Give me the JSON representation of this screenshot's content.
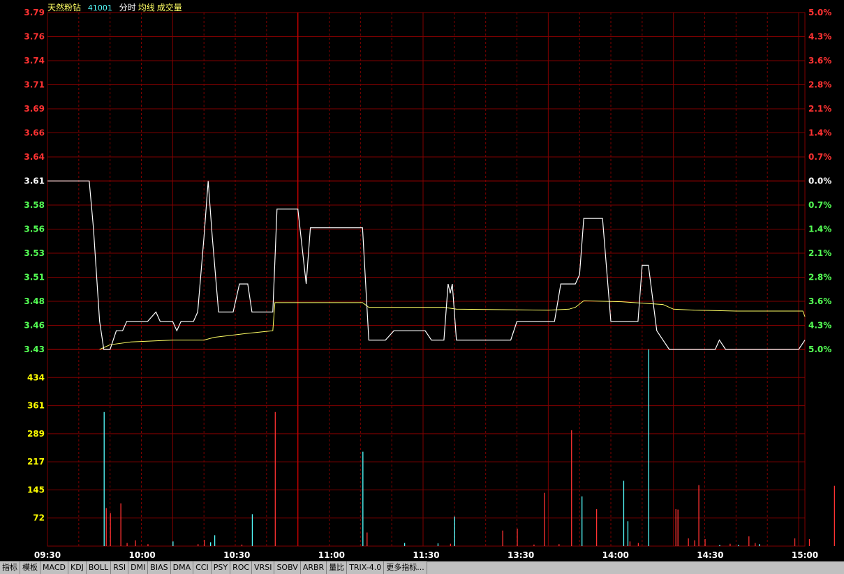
{
  "header": {
    "stock_name": "天然粉钻",
    "stock_code": "41001",
    "mode": "分时",
    "avg_label": "均线",
    "vol_label": "成交量"
  },
  "colors": {
    "up": "#ff3232",
    "down": "#54ff54",
    "flat": "#ffffff",
    "price_line": "#ffffff",
    "avg_line": "#ffff64",
    "vol_down": "#54ffff",
    "vol_up": "#ff3232",
    "grid": "#800000",
    "vol_axis": "#ffff00"
  },
  "tabs": [
    "指标",
    "模板",
    "MACD",
    "KDJ",
    "BOLL",
    "RSI",
    "DMI",
    "BIAS",
    "DMA",
    "CCI",
    "PSY",
    "ROC",
    "VRSI",
    "SOBV",
    "ARBR",
    "量比",
    "TRIX-4.0",
    "更多指标..."
  ],
  "chart_data": {
    "type": "line",
    "x_labels": [
      "09:30",
      "10:00",
      "10:30",
      "11:00",
      "11:30",
      "13:30",
      "14:00",
      "14:30",
      "15:00"
    ],
    "price_axis_labels": [
      "3.79",
      "3.76",
      "3.74",
      "3.71",
      "3.69",
      "3.66",
      "3.64",
      "3.61",
      "3.58",
      "3.56",
      "3.53",
      "3.51",
      "3.48",
      "3.46",
      "3.43"
    ],
    "pct_axis_labels": [
      "5.0%",
      "4.3%",
      "3.6%",
      "2.8%",
      "2.1%",
      "1.4%",
      "0.7%",
      "0.0%",
      "0.7%",
      "1.4%",
      "2.1%",
      "2.8%",
      "3.6%",
      "4.3%",
      "5.0%"
    ],
    "volume_axis_labels": [
      "434",
      "361",
      "289",
      "217",
      "145",
      "72"
    ],
    "pre_close": 3.61,
    "price_range": [
      3.43,
      3.79
    ],
    "volume_range": [
      0,
      506
    ],
    "price": [
      [
        0,
        3.61
      ],
      [
        20,
        3.61
      ],
      [
        22,
        3.56
      ],
      [
        25,
        3.46
      ],
      [
        27,
        3.43
      ],
      [
        30,
        3.43
      ],
      [
        33,
        3.45
      ],
      [
        36,
        3.45
      ],
      [
        38,
        3.46
      ],
      [
        45,
        3.46
      ],
      [
        48,
        3.46
      ],
      [
        52,
        3.47
      ],
      [
        54,
        3.46
      ],
      [
        60,
        3.46
      ],
      [
        62,
        3.45
      ],
      [
        64,
        3.46
      ],
      [
        70,
        3.46
      ],
      [
        72,
        3.47
      ],
      [
        75,
        3.55
      ],
      [
        77,
        3.61
      ],
      [
        79,
        3.55
      ],
      [
        82,
        3.47
      ],
      [
        89,
        3.47
      ],
      [
        92,
        3.5
      ],
      [
        96,
        3.5
      ],
      [
        98,
        3.47
      ],
      [
        108,
        3.47
      ],
      [
        110,
        3.58
      ],
      [
        120,
        3.58
      ],
      [
        124,
        3.5
      ],
      [
        126,
        3.56
      ],
      [
        151,
        3.56
      ],
      [
        154,
        3.44
      ],
      [
        162,
        3.44
      ],
      [
        166,
        3.45
      ],
      [
        181,
        3.45
      ],
      [
        184,
        3.44
      ],
      [
        190,
        3.44
      ],
      [
        192,
        3.5
      ],
      [
        193,
        3.49
      ],
      [
        194,
        3.5
      ],
      [
        196,
        3.44
      ],
      [
        222,
        3.44
      ],
      [
        225,
        3.46
      ],
      [
        243,
        3.46
      ],
      [
        246,
        3.5
      ],
      [
        253,
        3.5
      ],
      [
        255,
        3.51
      ],
      [
        257,
        3.57
      ],
      [
        266,
        3.57
      ],
      [
        270,
        3.46
      ],
      [
        283,
        3.46
      ],
      [
        285,
        3.52
      ],
      [
        288,
        3.52
      ],
      [
        292,
        3.45
      ],
      [
        295,
        3.44
      ],
      [
        298,
        3.43
      ],
      [
        320,
        3.43
      ],
      [
        322,
        3.44
      ],
      [
        325,
        3.43
      ],
      [
        360,
        3.43
      ],
      [
        363,
        3.44
      ]
    ],
    "avg": [
      [
        25,
        3.43
      ],
      [
        30,
        3.435
      ],
      [
        40,
        3.438
      ],
      [
        60,
        3.44
      ],
      [
        75,
        3.44
      ],
      [
        80,
        3.443
      ],
      [
        95,
        3.447
      ],
      [
        108,
        3.45
      ],
      [
        109,
        3.48
      ],
      [
        151,
        3.48
      ],
      [
        154,
        3.475
      ],
      [
        190,
        3.475
      ],
      [
        196,
        3.473
      ],
      [
        240,
        3.472
      ],
      [
        250,
        3.473
      ],
      [
        253,
        3.475
      ],
      [
        257,
        3.482
      ],
      [
        275,
        3.481
      ],
      [
        295,
        3.478
      ],
      [
        300,
        3.473
      ],
      [
        310,
        3.472
      ],
      [
        330,
        3.471
      ],
      [
        362,
        3.471
      ],
      [
        363,
        3.465
      ]
    ],
    "volume": [
      [
        27,
        345,
        "down"
      ],
      [
        28,
        98,
        "up"
      ],
      [
        30,
        85,
        "up"
      ],
      [
        35,
        110,
        "up"
      ],
      [
        38,
        8,
        "up"
      ],
      [
        42,
        15,
        "up"
      ],
      [
        48,
        5,
        "up"
      ],
      [
        60,
        12,
        "down"
      ],
      [
        72,
        5,
        "up"
      ],
      [
        75,
        16,
        "up"
      ],
      [
        78,
        10,
        "down"
      ],
      [
        80,
        28,
        "down"
      ],
      [
        93,
        4,
        "up"
      ],
      [
        98,
        82,
        "down"
      ],
      [
        109,
        345,
        "up"
      ],
      [
        151,
        243,
        "down"
      ],
      [
        153,
        35,
        "up"
      ],
      [
        171,
        8,
        "down"
      ],
      [
        187,
        7,
        "down"
      ],
      [
        193,
        6,
        "up"
      ],
      [
        195,
        76,
        "down"
      ],
      [
        218,
        40,
        "up"
      ],
      [
        225,
        45,
        "up"
      ],
      [
        233,
        4,
        "up"
      ],
      [
        238,
        137,
        "up"
      ],
      [
        245,
        5,
        "up"
      ],
      [
        251,
        298,
        "up"
      ],
      [
        256,
        128,
        "down"
      ],
      [
        263,
        95,
        "up"
      ],
      [
        276,
        168,
        "down"
      ],
      [
        278,
        64,
        "down"
      ],
      [
        279,
        12,
        "up"
      ],
      [
        283,
        8,
        "up"
      ],
      [
        288,
        506,
        "down"
      ],
      [
        301,
        95,
        "up"
      ],
      [
        302,
        94,
        "up"
      ],
      [
        307,
        20,
        "up"
      ],
      [
        310,
        15,
        "up"
      ],
      [
        312,
        157,
        "up"
      ],
      [
        315,
        18,
        "up"
      ],
      [
        322,
        3,
        "down"
      ],
      [
        327,
        6,
        "up"
      ],
      [
        331,
        3,
        "down"
      ],
      [
        336,
        25,
        "up"
      ],
      [
        339,
        8,
        "up"
      ],
      [
        341,
        5,
        "down"
      ],
      [
        358,
        20,
        "up"
      ],
      [
        365,
        18,
        "up"
      ],
      [
        377,
        155,
        "up"
      ]
    ]
  }
}
